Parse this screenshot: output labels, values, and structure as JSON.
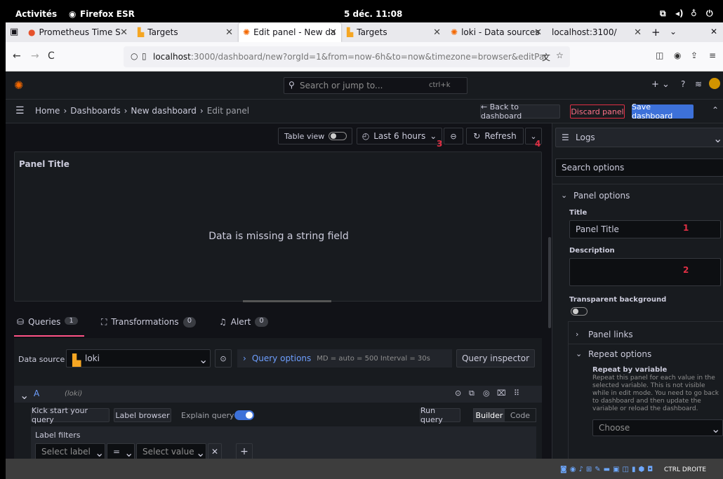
{
  "gnome": {
    "activities": "Activités",
    "app": "Firefox ESR",
    "clock": "5 déc. 11:08"
  },
  "tabs": [
    {
      "label": "Prometheus Time S",
      "active": false
    },
    {
      "label": "Targets",
      "active": false
    },
    {
      "label": "Edit panel - New da",
      "active": true
    },
    {
      "label": "Targets",
      "active": false
    },
    {
      "label": "loki - Data sources",
      "active": false
    },
    {
      "label": "localhost:3100/",
      "active": false
    }
  ],
  "url": {
    "host": "localhost",
    "rest": ":3000/dashboard/new?orgId=1&from=now-6h&to=now&timezone=browser&editPanel=1"
  },
  "grafana": {
    "search_placeholder": "Search or jump to...",
    "search_shortcut": "ctrl+k",
    "breadcrumb": [
      "Home",
      "Dashboards",
      "New dashboard",
      "Edit panel"
    ],
    "back_label": "← Back to dashboard",
    "discard_label": "Discard panel",
    "save_label": "Save dashboard",
    "toolbar": {
      "table_view": "Table view",
      "time_range": "Last 6 hours",
      "refresh": "Refresh"
    },
    "panel": {
      "title": "Panel Title",
      "message": "Data is missing a string field"
    },
    "query_tabs": [
      {
        "label": "Queries",
        "count": "1"
      },
      {
        "label": "Transformations",
        "count": "0"
      },
      {
        "label": "Alert",
        "count": "0"
      }
    ],
    "datasource": {
      "label": "Data source",
      "value": "loki",
      "query_options": "Query options",
      "meta": "MD = auto = 500   Interval = 30s",
      "inspector": "Query inspector"
    },
    "query_row": {
      "letter": "A",
      "source": "(loki)"
    },
    "query_actions": {
      "kick": "Kick start your query",
      "browser": "Label browser",
      "explain": "Explain query",
      "run": "Run query",
      "builder": "Builder",
      "code": "Code"
    },
    "label_filters": {
      "heading": "Label filters",
      "label_placeholder": "Select label",
      "op": "=",
      "value_placeholder": "Select value"
    },
    "options": {
      "viz": "Logs",
      "search_placeholder": "Search options",
      "panel_options": "Panel options",
      "title_label": "Title",
      "title_value": "Panel Title",
      "description_label": "Description",
      "transparent_label": "Transparent background",
      "panel_links": "Panel links",
      "repeat_options": "Repeat options",
      "repeat_by_label": "Repeat by variable",
      "repeat_help": "Repeat this panel for each value in the selected variable. This is not visible while in edit mode. You need to go back to dashboard and then update the variable or reload the dashboard.",
      "choose": "Choose"
    }
  },
  "annotations": {
    "a1": "1",
    "a2": "2",
    "a3": "3",
    "a4": "4"
  },
  "taskbar": {
    "right_ctrl": "CTRL DROITE"
  },
  "colors": {
    "accent": "#3d71d9",
    "danger": "#e02f44",
    "panel_bg": "#181b1f",
    "page_bg": "#111217"
  }
}
